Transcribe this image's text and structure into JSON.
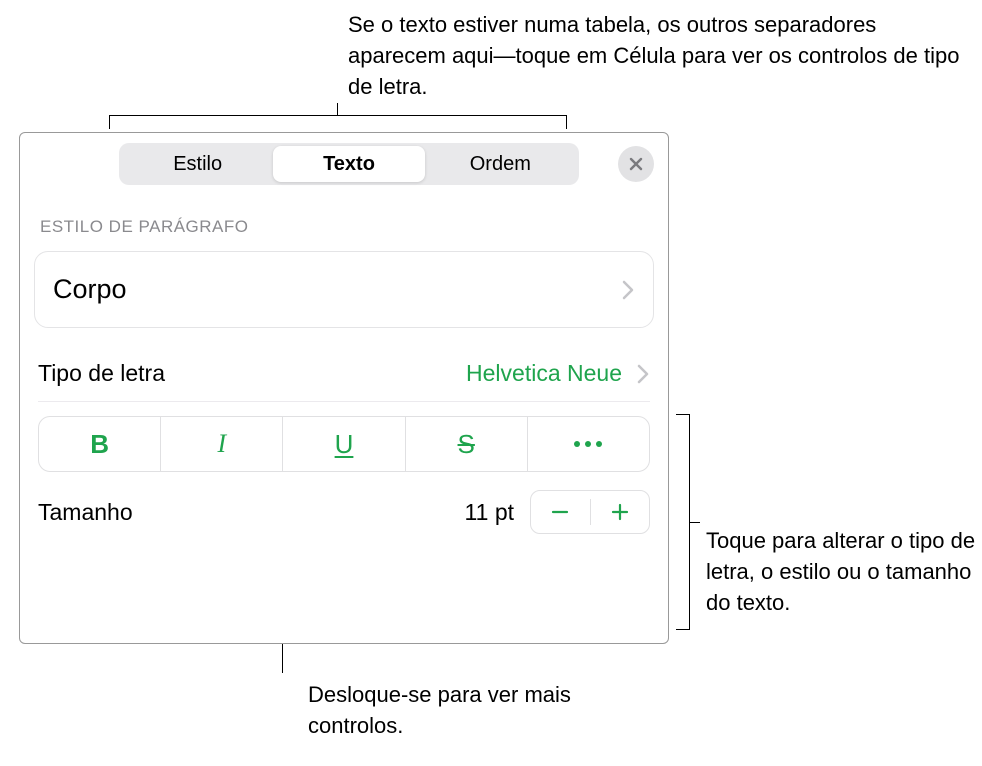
{
  "annotations": {
    "top": "Se o texto estiver numa tabela, os outros separadores aparecem aqui—toque em Célula para ver os controlos de tipo de letra.",
    "right": "Toque para alterar o tipo de letra, o estilo ou o tamanho do texto.",
    "bottom": "Desloque-se para ver mais controlos."
  },
  "tabs": {
    "style": "Estilo",
    "text": "Texto",
    "order": "Ordem"
  },
  "section": {
    "paragraph_style_label": "ESTILO DE PARÁGRAFO"
  },
  "paragraph_style": {
    "value": "Corpo"
  },
  "font": {
    "label": "Tipo de letra",
    "value": "Helvetica Neue"
  },
  "style_buttons": {
    "bold": "B",
    "italic": "I",
    "underline": "U",
    "strike": "S"
  },
  "size": {
    "label": "Tamanho",
    "value": "11 pt"
  },
  "icons": {
    "close": "close-icon",
    "chevron": "chevron-right-icon",
    "minus": "−",
    "plus": "+"
  }
}
